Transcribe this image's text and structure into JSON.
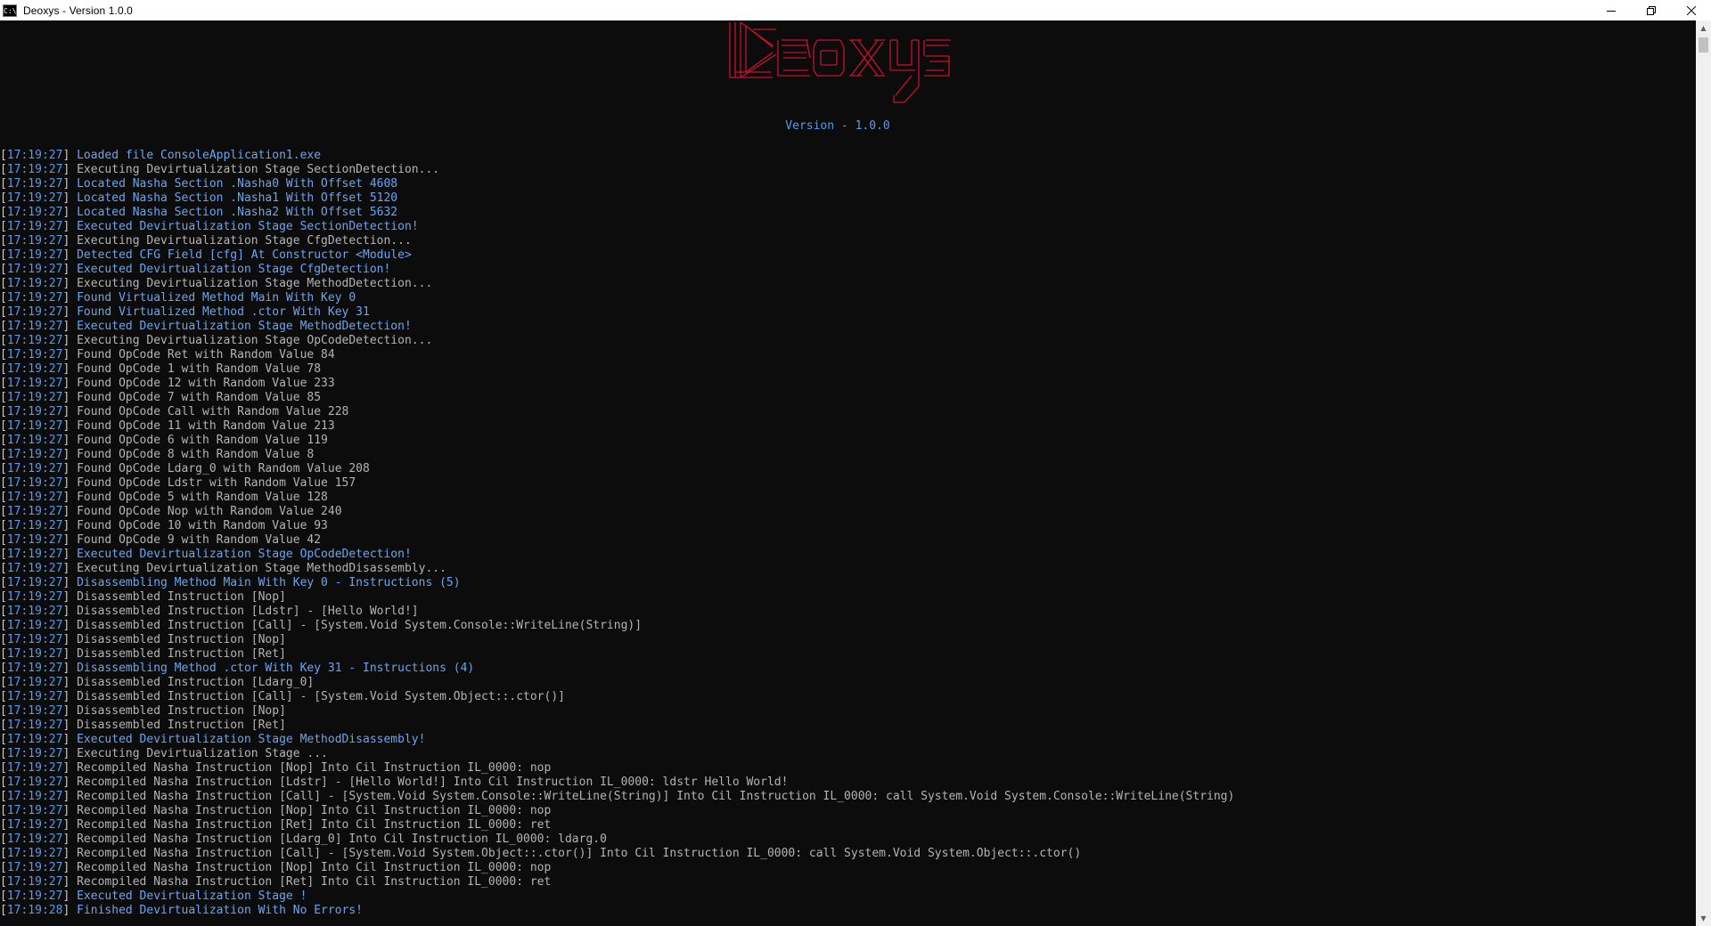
{
  "window": {
    "title": "Deoxys - Version 1.0.0",
    "icon_label": "C:\\"
  },
  "banner": {
    "art_name": "Deoxys",
    "color": "#c8102e",
    "version_text": "Version - 1.0.0"
  },
  "log": [
    {
      "time": "17:19:27",
      "msg": "Loaded file ConsoleApplication1.exe",
      "style": "info"
    },
    {
      "time": "17:19:27",
      "msg": "Executing Devirtualization Stage SectionDetection...",
      "style": "plain"
    },
    {
      "time": "17:19:27",
      "msg": "Located Nasha Section .Nasha0 With Offset 4608",
      "style": "info"
    },
    {
      "time": "17:19:27",
      "msg": "Located Nasha Section .Nasha1 With Offset 5120",
      "style": "info"
    },
    {
      "time": "17:19:27",
      "msg": "Located Nasha Section .Nasha2 With Offset 5632",
      "style": "info"
    },
    {
      "time": "17:19:27",
      "msg": "Executed Devirtualization Stage SectionDetection!",
      "style": "info"
    },
    {
      "time": "17:19:27",
      "msg": "Executing Devirtualization Stage CfgDetection...",
      "style": "plain"
    },
    {
      "time": "17:19:27",
      "msg": "Detected CFG Field [cfg] At Constructor <Module>",
      "style": "info"
    },
    {
      "time": "17:19:27",
      "msg": "Executed Devirtualization Stage CfgDetection!",
      "style": "info"
    },
    {
      "time": "17:19:27",
      "msg": "Executing Devirtualization Stage MethodDetection...",
      "style": "plain"
    },
    {
      "time": "17:19:27",
      "msg": "Found Virtualized Method Main With Key 0",
      "style": "info"
    },
    {
      "time": "17:19:27",
      "msg": "Found Virtualized Method .ctor With Key 31",
      "style": "info"
    },
    {
      "time": "17:19:27",
      "msg": "Executed Devirtualization Stage MethodDetection!",
      "style": "info"
    },
    {
      "time": "17:19:27",
      "msg": "Executing Devirtualization Stage OpCodeDetection...",
      "style": "plain"
    },
    {
      "time": "17:19:27",
      "msg": "Found OpCode Ret with Random Value 84",
      "style": "plain"
    },
    {
      "time": "17:19:27",
      "msg": "Found OpCode 1 with Random Value 78",
      "style": "plain"
    },
    {
      "time": "17:19:27",
      "msg": "Found OpCode 12 with Random Value 233",
      "style": "plain"
    },
    {
      "time": "17:19:27",
      "msg": "Found OpCode 7 with Random Value 85",
      "style": "plain"
    },
    {
      "time": "17:19:27",
      "msg": "Found OpCode Call with Random Value 228",
      "style": "plain"
    },
    {
      "time": "17:19:27",
      "msg": "Found OpCode 11 with Random Value 213",
      "style": "plain"
    },
    {
      "time": "17:19:27",
      "msg": "Found OpCode 6 with Random Value 119",
      "style": "plain"
    },
    {
      "time": "17:19:27",
      "msg": "Found OpCode 8 with Random Value 8",
      "style": "plain"
    },
    {
      "time": "17:19:27",
      "msg": "Found OpCode Ldarg_0 with Random Value 208",
      "style": "plain"
    },
    {
      "time": "17:19:27",
      "msg": "Found OpCode Ldstr with Random Value 157",
      "style": "plain"
    },
    {
      "time": "17:19:27",
      "msg": "Found OpCode 5 with Random Value 128",
      "style": "plain"
    },
    {
      "time": "17:19:27",
      "msg": "Found OpCode Nop with Random Value 240",
      "style": "plain"
    },
    {
      "time": "17:19:27",
      "msg": "Found OpCode 10 with Random Value 93",
      "style": "plain"
    },
    {
      "time": "17:19:27",
      "msg": "Found OpCode 9 with Random Value 42",
      "style": "plain"
    },
    {
      "time": "17:19:27",
      "msg": "Executed Devirtualization Stage OpCodeDetection!",
      "style": "info"
    },
    {
      "time": "17:19:27",
      "msg": "Executing Devirtualization Stage MethodDisassembly...",
      "style": "plain"
    },
    {
      "time": "17:19:27",
      "msg": "Disassembling Method Main With Key 0 - Instructions (5)",
      "style": "info"
    },
    {
      "time": "17:19:27",
      "msg": "Disassembled Instruction [Nop]",
      "style": "plain"
    },
    {
      "time": "17:19:27",
      "msg": "Disassembled Instruction [Ldstr] - [Hello World!]",
      "style": "plain"
    },
    {
      "time": "17:19:27",
      "msg": "Disassembled Instruction [Call] - [System.Void System.Console::WriteLine(String)]",
      "style": "plain"
    },
    {
      "time": "17:19:27",
      "msg": "Disassembled Instruction [Nop]",
      "style": "plain"
    },
    {
      "time": "17:19:27",
      "msg": "Disassembled Instruction [Ret]",
      "style": "plain"
    },
    {
      "time": "17:19:27",
      "msg": "Disassembling Method .ctor With Key 31 - Instructions (4)",
      "style": "info"
    },
    {
      "time": "17:19:27",
      "msg": "Disassembled Instruction [Ldarg_0]",
      "style": "plain"
    },
    {
      "time": "17:19:27",
      "msg": "Disassembled Instruction [Call] - [System.Void System.Object::.ctor()]",
      "style": "plain"
    },
    {
      "time": "17:19:27",
      "msg": "Disassembled Instruction [Nop]",
      "style": "plain"
    },
    {
      "time": "17:19:27",
      "msg": "Disassembled Instruction [Ret]",
      "style": "plain"
    },
    {
      "time": "17:19:27",
      "msg": "Executed Devirtualization Stage MethodDisassembly!",
      "style": "info"
    },
    {
      "time": "17:19:27",
      "msg": "Executing Devirtualization Stage ...",
      "style": "plain"
    },
    {
      "time": "17:19:27",
      "msg": "Recompiled Nasha Instruction [Nop] Into Cil Instruction IL_0000: nop",
      "style": "plain"
    },
    {
      "time": "17:19:27",
      "msg": "Recompiled Nasha Instruction [Ldstr] - [Hello World!] Into Cil Instruction IL_0000: ldstr Hello World!",
      "style": "plain"
    },
    {
      "time": "17:19:27",
      "msg": "Recompiled Nasha Instruction [Call] - [System.Void System.Console::WriteLine(String)] Into Cil Instruction IL_0000: call System.Void System.Console::WriteLine(String)",
      "style": "plain"
    },
    {
      "time": "17:19:27",
      "msg": "Recompiled Nasha Instruction [Nop] Into Cil Instruction IL_0000: nop",
      "style": "plain"
    },
    {
      "time": "17:19:27",
      "msg": "Recompiled Nasha Instruction [Ret] Into Cil Instruction IL_0000: ret",
      "style": "plain"
    },
    {
      "time": "17:19:27",
      "msg": "Recompiled Nasha Instruction [Ldarg_0] Into Cil Instruction IL_0000: ldarg.0",
      "style": "plain"
    },
    {
      "time": "17:19:27",
      "msg": "Recompiled Nasha Instruction [Call] - [System.Void System.Object::.ctor()] Into Cil Instruction IL_0000: call System.Void System.Object::.ctor()",
      "style": "plain"
    },
    {
      "time": "17:19:27",
      "msg": "Recompiled Nasha Instruction [Nop] Into Cil Instruction IL_0000: nop",
      "style": "plain"
    },
    {
      "time": "17:19:27",
      "msg": "Recompiled Nasha Instruction [Ret] Into Cil Instruction IL_0000: ret",
      "style": "plain"
    },
    {
      "time": "17:19:27",
      "msg": "Executed Devirtualization Stage !",
      "style": "info"
    },
    {
      "time": "17:19:28",
      "msg": "Finished Devirtualization With No Errors!",
      "style": "info"
    }
  ]
}
